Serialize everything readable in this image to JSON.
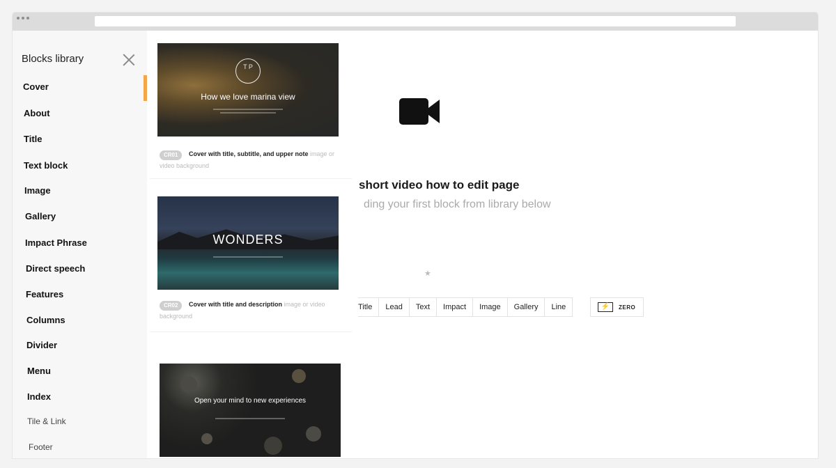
{
  "sidebar": {
    "title": "Blocks library",
    "items": [
      {
        "label": "Cover"
      },
      {
        "label": "About"
      },
      {
        "label": "Title"
      },
      {
        "label": "Text block"
      },
      {
        "label": "Image"
      },
      {
        "label": "Gallery"
      },
      {
        "label": "Impact Phrase"
      },
      {
        "label": "Direct speech"
      },
      {
        "label": "Features"
      },
      {
        "label": "Columns"
      },
      {
        "label": "Divider"
      },
      {
        "label": "Menu"
      },
      {
        "label": "Index"
      },
      {
        "label": "Tile & Link"
      },
      {
        "label": "Footer"
      }
    ],
    "active_item": "Cover",
    "accent_color": "#f4a64b"
  },
  "blocks": [
    {
      "thumb_title": "How we love marina view",
      "logo_text": "T P",
      "code": "CR01",
      "name": "Cover with title, subtitle, and upper note",
      "note": "image or video background"
    },
    {
      "thumb_title": "WONDERS",
      "code": "CR02",
      "name": "Cover with title and description",
      "note": "image or video background"
    },
    {
      "thumb_title": "Open your mind to new experiences"
    }
  ],
  "main": {
    "video_title": "short video how to edit page",
    "video_subtitle": "ding your first block from library below",
    "buttons": [
      "Title",
      "Lead",
      "Text",
      "Impact",
      "Image",
      "Gallery",
      "Line"
    ],
    "zero_label": "ZERO",
    "icons": {
      "video": "video-camera-icon",
      "star": "star-icon",
      "zero": "lightning-bolt-icon",
      "close": "close-icon"
    }
  }
}
